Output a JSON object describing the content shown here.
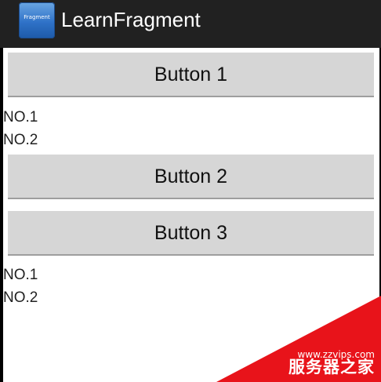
{
  "app": {
    "icon_name": "fragment-app-icon",
    "icon_text": "Fragment",
    "title": "LearnFragment"
  },
  "content": {
    "button1_label": "Button 1",
    "list1": [
      "NO.1",
      "NO.2"
    ],
    "button2_label": "Button 2",
    "button3_label": "Button 3",
    "list2": [
      "NO.1",
      "NO.2"
    ]
  },
  "watermark": {
    "url": "www.zzvips.com",
    "name": "服务器之家"
  },
  "colors": {
    "action_bar": "#212121",
    "button": "#d6d6d6",
    "watermark": "#e8131a"
  }
}
